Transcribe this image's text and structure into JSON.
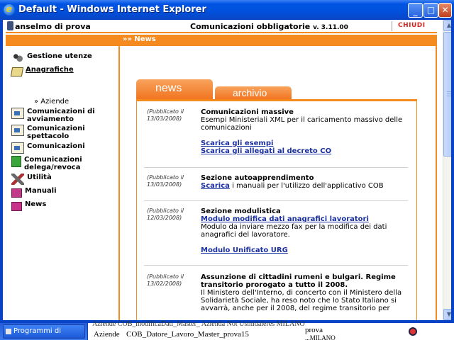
{
  "window": {
    "title": "Default - Windows Internet Explorer",
    "buttons": {
      "minimize": "_",
      "maximize": "□",
      "close": "✕"
    }
  },
  "header": {
    "user": "anselmo di prova",
    "app_title": "Comunicazioni obbligatorie",
    "version": "v. 3.11.00",
    "close_label": "CHIUDI"
  },
  "breadcrumb": "»» News",
  "nav": {
    "items": [
      {
        "label": "Gestione utenze",
        "icon": "users-icon"
      },
      {
        "label": "Anagrafiche",
        "icon": "book-icon"
      },
      {
        "label": "Comunicazioni di avviamento",
        "icon": "document-icon"
      },
      {
        "label": "Comunicazioni spettacolo",
        "icon": "document-icon"
      },
      {
        "label": "Comunicazioni",
        "icon": "document-icon"
      },
      {
        "label": "Comunicazioni delega/revoca",
        "icon": "green-doc-icon"
      },
      {
        "label": "Utilità",
        "icon": "tools-icon"
      },
      {
        "label": "Manuali",
        "icon": "manual-icon"
      },
      {
        "label": "News",
        "icon": "news-icon"
      }
    ],
    "sub_item": "» Aziende"
  },
  "tabs": {
    "news": "news",
    "archivio": "archivio"
  },
  "news": [
    {
      "date": "(Pubblicato il 13/03/2008)",
      "title": "Comunicazioni massive",
      "text": "Esempi Ministeriali XML per il caricamento massivo delle comunicazioni",
      "links": [
        "Scarica gli esempi",
        "Scarica gli allegati al decreto CO"
      ]
    },
    {
      "date": "(Pubblicato il 13/03/2008)",
      "title": "Sezione autoapprendimento",
      "link_inline": "Scarica",
      "text_after": " i manuali per l'utilizzo dell'applicativo COB"
    },
    {
      "date": "(Pubblicato il 12/03/2008)",
      "title": "Sezione modulistica",
      "link1": "Modulo modifica dati anagrafici lavoratori",
      "text": "Modulo da inviare mezzo fax per la modifica dei dati anagrafici del lavoratore.",
      "link2": "Modulo Unificato URG"
    },
    {
      "date": "(Pubblicato il 13/02/2008)",
      "title": "Assunzione di cittadini rumeni e bulgari. Regime transitorio prorogato a tutto il 2008.",
      "text": "Il Ministero dell'Interno, di concerto con il Ministero della Solidarietà Sociale, ha reso noto che lo Stato Italiano si avvarrà, anche per il 2008, del regime transitorio per"
    }
  ],
  "taskbar": {
    "program_label": "Programmi di",
    "bg_row1": "Aziende   COB_modificaDati_Master_  Azienda Not Usinidaleres  MILANO",
    "bg_row2_col1": "Aziende",
    "bg_row2_col2": "COB_Datore_Lavoro_Master_prova15",
    "bg_row2_col3": "prova",
    "bg_row2_col4": "...MILANO"
  },
  "colors": {
    "accent": "#f58a1f",
    "link": "#1a2fa0",
    "close": "#d7261e"
  }
}
